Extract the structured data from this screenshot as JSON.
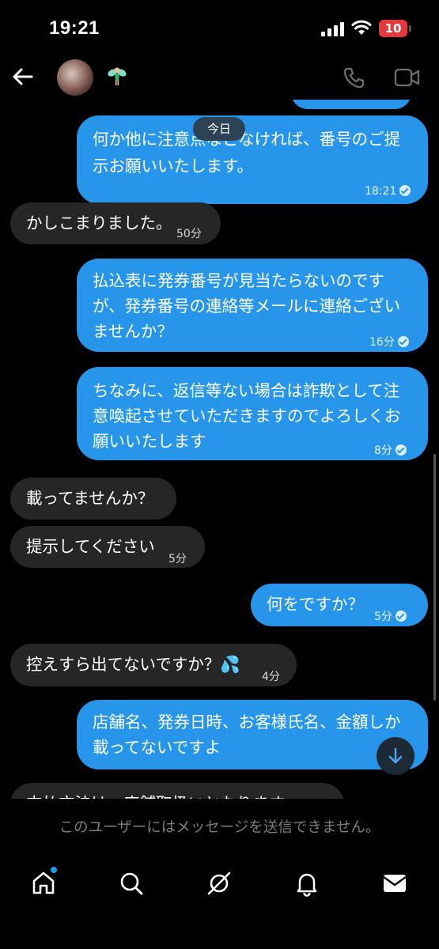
{
  "status_bar": {
    "time": "19:21",
    "battery": "10"
  },
  "header": {
    "title_emoji": "🧚"
  },
  "chat": {
    "day_divider": "今日",
    "messages": [
      {
        "from": "me",
        "text1": "何か他に注意点などなければ、番号のご提",
        "text2": "示お願いいたします。",
        "time": "18:21"
      },
      {
        "from": "them",
        "text": "かしこまりました。",
        "time": "50分"
      },
      {
        "from": "me",
        "text1": "払込表に発券番号が見当たらないのです",
        "text2": "が、発券番号の連絡等メールに連絡ござい",
        "text3": "ませんか？",
        "time": "16分"
      },
      {
        "from": "me",
        "text1": "ちなみに、返信等ない場合は詐欺として注",
        "text2": "意喚起させていただきますのでよろしくお",
        "text3": "願いいたします",
        "time": "8分"
      },
      {
        "from": "them",
        "text": "載ってませんか？"
      },
      {
        "from": "them",
        "text": "提示してください",
        "time": "5分"
      },
      {
        "from": "me",
        "text": "何をですか？",
        "time": "5分"
      },
      {
        "from": "them",
        "text": "控えすら出てないですか？💦",
        "time": "4分"
      },
      {
        "from": "me",
        "text1": "店舗名、発券日時、お客様氏名、金額しか",
        "text2": "載ってないですよ"
      },
      {
        "from": "them",
        "text": "支払方法は、店舗取扱いとなります。"
      }
    ]
  },
  "footer": {
    "notice": "このユーザーにはメッセージを送信できません。"
  },
  "colors": {
    "sent_bubble": "#2796ea",
    "received_bubble": "#262626",
    "background": "#000000"
  },
  "nav": [
    "home-icon",
    "search-icon",
    "explore-icon",
    "bell-icon",
    "mail-icon"
  ]
}
